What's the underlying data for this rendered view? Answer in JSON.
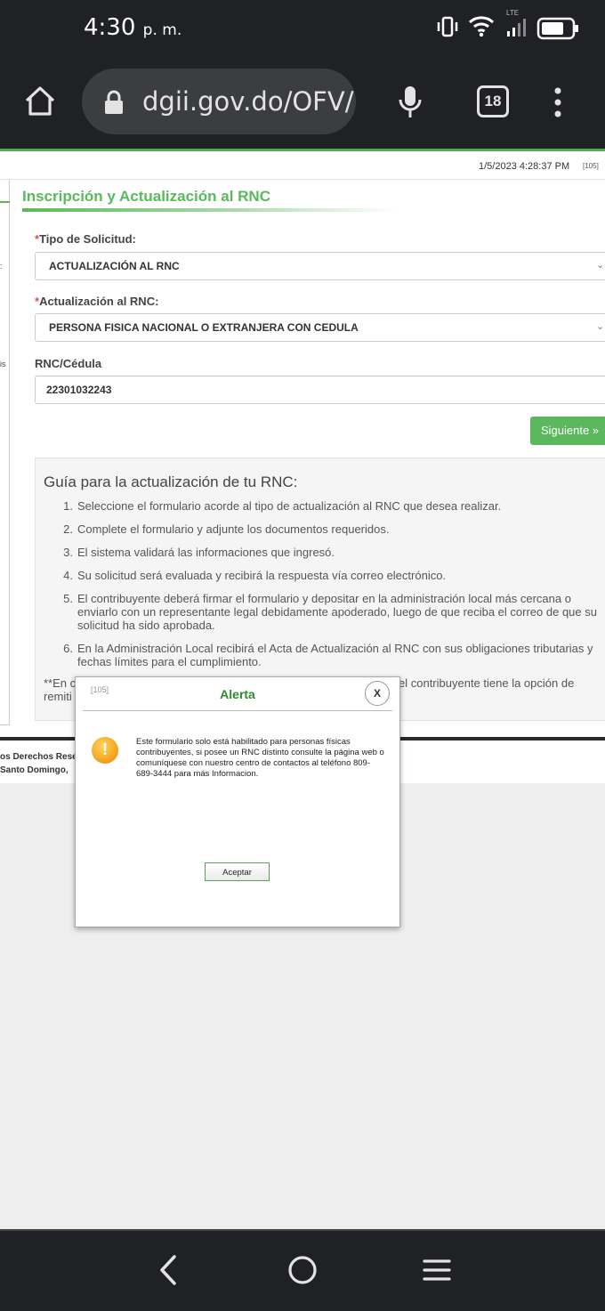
{
  "status_bar": {
    "time": "4:30",
    "ampm": "p. m.",
    "network": "LTE"
  },
  "browser": {
    "url": "dgii.gov.do/OFV/",
    "tab_count": "18"
  },
  "header": {
    "timestamp": "1/5/2023 4:28:37 PM",
    "code": "[105]"
  },
  "sidebar": {
    "fragment_1": ":",
    "fragment_2": "is"
  },
  "form": {
    "title": "Inscripción y Actualización al RNC",
    "tipo_label": "Tipo de Solicitud:",
    "tipo_value": "ACTUALIZACIÓN AL RNC",
    "actualizacion_label": "Actualización al RNC:",
    "actualizacion_value": "PERSONA FISICA NACIONAL O EXTRANJERA CON CEDULA",
    "rnc_label": "RNC/Cédula",
    "rnc_value": "22301032243",
    "required_mark": "*",
    "next_button": "Siguiente »"
  },
  "guide": {
    "title": "Guía para la actualización de tu RNC:",
    "items": [
      "Seleccione el formulario acorde al tipo de actualización al RNC que desea realizar.",
      "Complete el formulario y adjunte los documentos requeridos.",
      "El sistema validará las informaciones que ingresó.",
      "Su solicitud será evaluada y recibirá la respuesta vía correo electrónico.",
      "El contribuyente deberá firmar el formulario y depositar en la administración local más cercana o enviarlo con un representante legal debidamente apoderado, luego de que reciba el correo de que su solicitud ha sido aprobada.",
      "En la Administración Local recibirá el Acta de Actualización al RNC con sus obligaciones tributarias y fechas límites para el cumplimiento."
    ],
    "note_left_1": "**En c",
    "note_left_2": "remiti",
    "note_right": "el contribuyente tiene la opción de"
  },
  "footer": {
    "line1": "os Derechos Rese",
    "line2": " Santo Domingo,"
  },
  "modal": {
    "code": "[105]",
    "title": "Alerta",
    "close": "X",
    "icon": "warning-icon",
    "message": "Este formulario solo está habilitado para personas físicas contribuyentes, si posee un RNC distinto consulte la página web o comuníquese con nuestro centro de contactos al teléfono 809-689-3444 para más Informacion.",
    "accept": "Aceptar"
  },
  "colors": {
    "accent_green": "#5cb85c",
    "title_green": "#2e8b2e",
    "chrome_dark": "#202124"
  }
}
